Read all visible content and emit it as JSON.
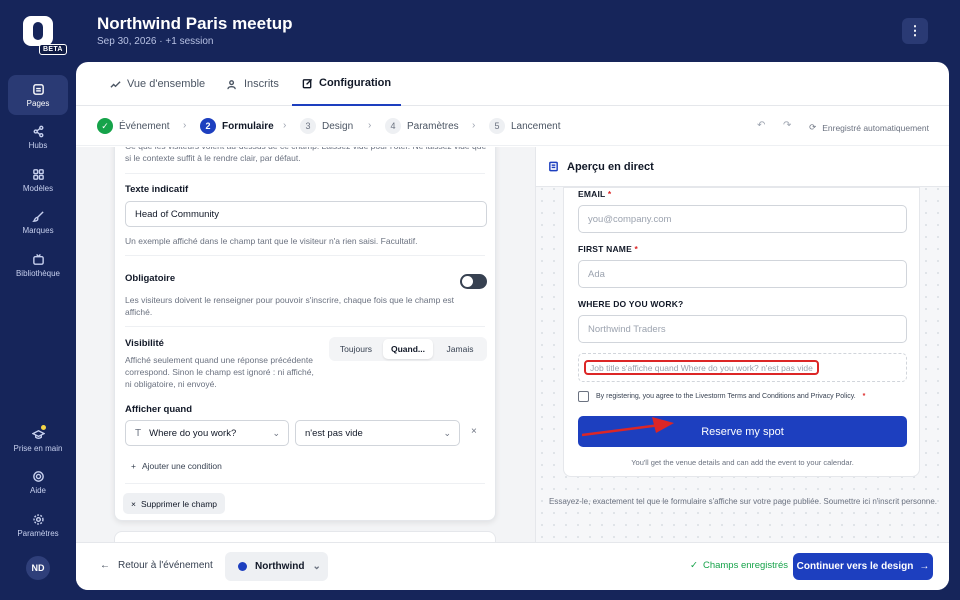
{
  "sidebar": {
    "badge": "BETA",
    "items": [
      {
        "label": "Pages",
        "icon": "pages-icon"
      },
      {
        "label": "Hubs",
        "icon": "share-icon"
      },
      {
        "label": "Modèles",
        "icon": "grid-icon"
      },
      {
        "label": "Marques",
        "icon": "brush-icon"
      },
      {
        "label": "Bibliothèque",
        "icon": "tv-icon"
      }
    ],
    "bottom_items": [
      {
        "label": "Prise en main",
        "icon": "graduation-icon"
      },
      {
        "label": "Aide",
        "icon": "lifebuoy-icon"
      },
      {
        "label": "Paramètres",
        "icon": "gear-icon"
      }
    ],
    "avatar_initials": "ND"
  },
  "header": {
    "title": "Northwind Paris meetup",
    "subtitle": "Sep 30, 2026 · +1 session",
    "menu_glyph": "⋮"
  },
  "tabs": [
    {
      "label": "Vue d'ensemble"
    },
    {
      "label": "Inscrits"
    },
    {
      "label": "Configuration"
    }
  ],
  "steps": [
    {
      "num": "✓",
      "label": "Événement"
    },
    {
      "num": "2",
      "label": "Formulaire"
    },
    {
      "num": "3",
      "label": "Design"
    },
    {
      "num": "4",
      "label": "Paramètres"
    },
    {
      "num": "5",
      "label": "Lancement"
    }
  ],
  "autosave": "Enregistré automatiquement",
  "form": {
    "faded_text": "Ce que les visiteurs voient au-dessus de ce champ. Laissez vide pour l'ôter. Ne laissez vide que si le contexte suffit à le rendre clair, par défaut.",
    "placeholder_label": "Texte indicatif",
    "placeholder_value": "Head of Community",
    "placeholder_help": "Un exemple affiché dans le champ tant que le visiteur n'a rien saisi. Facultatif.",
    "required_label": "Obligatoire",
    "required_help": "Les visiteurs doivent le renseigner pour pouvoir s'inscrire, chaque fois que le champ est affiché.",
    "visibility_label": "Visibilité",
    "visibility_help": "Affiché seulement quand une réponse précédente correspond. Sinon le champ est ignoré : ni affiché, ni obligatoire, ni envoyé.",
    "visibility_options": [
      "Toujours",
      "Quand...",
      "Jamais"
    ],
    "visibility_selected": "Quand...",
    "show_when_label": "Afficher quand",
    "condition_field": "Where do you work?",
    "condition_operator": "n'est pas vide",
    "add_condition": "Ajouter une condition",
    "delete_field": "Supprimer le champ"
  },
  "preview": {
    "title": "Aperçu en direct",
    "email_label": "EMAIL",
    "email_placeholder": "you@company.com",
    "first_name_label": "FIRST NAME",
    "first_name_placeholder": "Ada",
    "work_label": "WHERE DO YOU WORK?",
    "work_placeholder": "Northwind Traders",
    "hidden_field_note": "Job title s'affiche quand Where do you work? n'est pas vide",
    "consent": "By registering, you agree to the Livestorm Terms and Conditions and Privacy Policy.",
    "required_mark": "*",
    "button": "Reserve my spot",
    "after_note": "You'll get the venue details and can add the event to your calendar.",
    "footer_note": "Essayez-le, exactement tel que le formulaire s'affiche sur votre page publiée. Soumettre ici n'inscrit personne."
  },
  "bottom": {
    "back": "Retour à l'événement",
    "workspace": "Northwind",
    "saved": "Champs enregistrés",
    "continue": "Continuer vers le design"
  },
  "colors": {
    "primary": "#1d3fbf",
    "sidebar": "#16255a",
    "success": "#16a34a",
    "required": "#dc2626"
  }
}
